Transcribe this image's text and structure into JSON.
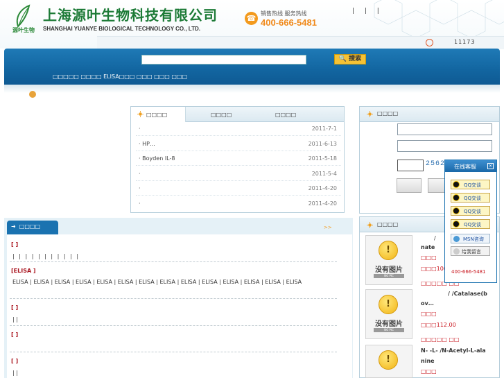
{
  "header": {
    "logo_sub": "源叶生物",
    "company_cn": "上海源叶生物科技有限公司",
    "company_en": "SHANGHAI YUANYE BIOLOGICAL TECHNOLOGY CO., LTD.",
    "hotline_label": "销售热线 服务热线",
    "hotline_number": "400-666-5481",
    "top_links": "| | |",
    "counter": "11173"
  },
  "search": {
    "button_label": "搜索",
    "hot_links": "□□□□□ □□□□ ELISA□□□ □□□ □□□ □□□"
  },
  "news": {
    "tabs": [
      "□□□□",
      "□□□□",
      "□□□□"
    ],
    "items": [
      {
        "title": "·",
        "date": "2011-7-1"
      },
      {
        "title": "·                    HP…",
        "date": "2011-6-13"
      },
      {
        "title": "· Boyden     IL-8",
        "date": "2011-5-18"
      },
      {
        "title": "·",
        "date": "2011-5-4"
      },
      {
        "title": "·",
        "date": "2011-4-20"
      },
      {
        "title": "·",
        "date": "2011-4-20"
      }
    ]
  },
  "login": {
    "title": "□□□□",
    "captcha": "2562"
  },
  "products": {
    "tab_label": "□□□□",
    "more_label": ">>",
    "categories": [
      {
        "title": "[     ]",
        "items": "|   |   |   |   |   |   |   |   |   |   |"
      },
      {
        "title": "[ELISA      ]",
        "items": "ELISA  |  ELISA  |  ELISA  |  ELISA  |  ELISA  |  ELISA  |  ELISA  |  ELISA  |  ELISA  |  ELISA  |  ELISA  |  ELISA  |  ELISA  |  ELISA"
      },
      {
        "title": "[         ]",
        "items": "|     |"
      },
      {
        "title": "[    ]",
        "items": ""
      },
      {
        "title": "[    ]",
        "items": "|     |"
      }
    ]
  },
  "right_products": {
    "title": "□□□□",
    "nopic_text": "没有图片",
    "nopic_sub": "NO PIC",
    "entries": [
      {
        "name_line1": "/",
        "name_line2": "nate",
        "label": "□□□",
        "price": "□□□100",
        "action": "□□□□□ □□"
      },
      {
        "name_line1": "/          /Catalase(b",
        "name_line2": "ov…",
        "label": "□□□",
        "price": "□□□112.00",
        "action": "□□□□□ □□"
      },
      {
        "name_line1": "N-    -L-     /N-Acetyl-L-ala",
        "name_line2": "nine",
        "label": "□□□",
        "price": "",
        "action": ""
      }
    ]
  },
  "qq_float": {
    "title": "在线客服",
    "close": "✕",
    "qq_label": "QQ交谈",
    "msn_label": "MSN咨询",
    "msg_label": "给我留言",
    "phone": "400-666-5481"
  }
}
